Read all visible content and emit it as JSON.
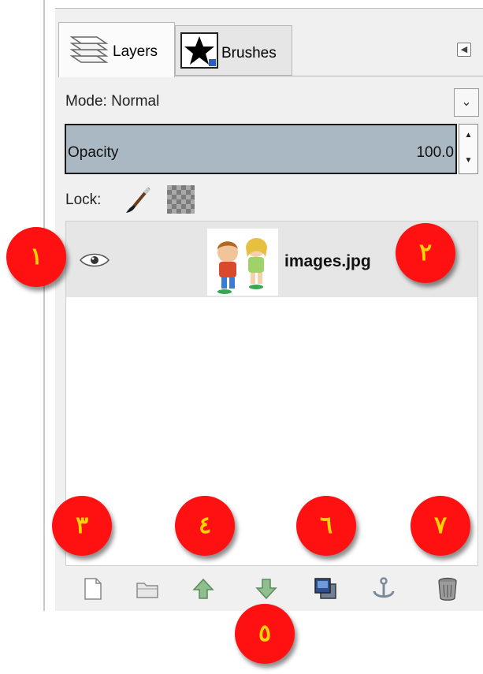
{
  "tabs": [
    {
      "label": "Layers",
      "icon": "layers-icon",
      "active": true
    },
    {
      "label": "Brushes",
      "icon": "star-brush-icon",
      "active": false
    }
  ],
  "mode": {
    "label": "Mode:",
    "value": "Normal"
  },
  "opacity": {
    "label": "Opacity",
    "value": "100.0"
  },
  "lock": {
    "label": "Lock:"
  },
  "layers": [
    {
      "name": "images.jpg",
      "visible": true
    }
  ],
  "toolbar_icons": [
    "new-layer-icon",
    "new-layer-group-icon",
    "raise-layer-icon",
    "lower-layer-icon",
    "duplicate-layer-icon",
    "anchor-layer-icon",
    "delete-layer-icon"
  ],
  "callouts": {
    "c1": "١",
    "c2": "٢",
    "c3": "٣",
    "c4": "٤",
    "c5": "٥",
    "c6": "٦",
    "c7": "٧"
  },
  "colors": {
    "callout_fill": "#ff1111",
    "callout_text": "#ffd400",
    "opacity_bar": "#aab8c4"
  }
}
